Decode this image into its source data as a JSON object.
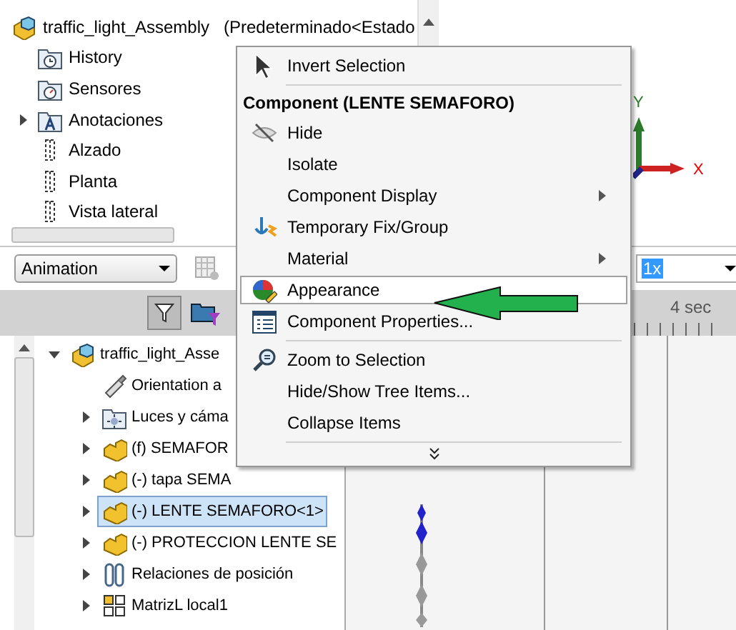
{
  "feature_tree": {
    "root": {
      "label": "traffic_light_Assembly",
      "config": "(Predeterminado<Estado",
      "kind": "assembly"
    },
    "items": [
      {
        "label": "History",
        "kind": "history"
      },
      {
        "label": "Sensores",
        "kind": "sensors"
      },
      {
        "label": "Anotaciones",
        "kind": "annotations",
        "expanded": false
      },
      {
        "label": "Alzado",
        "kind": "plane"
      },
      {
        "label": "Planta",
        "kind": "plane"
      },
      {
        "label": "Vista lateral",
        "kind": "plane"
      }
    ]
  },
  "graphics": {
    "axis_labels": [
      "Y",
      "X"
    ]
  },
  "motion_manager": {
    "study_type": "Animation",
    "playback_speed": "1x",
    "time_label": "4 sec",
    "tree": {
      "label": "traffic_light_Asse",
      "kind": "assembly",
      "expanded": true,
      "children": [
        {
          "label": "Orientation a",
          "kind": "orientation",
          "selected": false
        },
        {
          "label": "Luces y cáma",
          "kind": "lights",
          "expanded": false,
          "selected": false
        },
        {
          "label": "(f) SEMAFOR",
          "kind": "part",
          "expanded": false,
          "selected": false
        },
        {
          "label": "(-) tapa SEMA",
          "kind": "part",
          "expanded": false,
          "selected": false
        },
        {
          "label": "(-) LENTE SEMAFORO<1>",
          "kind": "part",
          "expanded": false,
          "selected": true
        },
        {
          "label": "(-) PROTECCION LENTE SE",
          "kind": "part",
          "expanded": false,
          "selected": false
        },
        {
          "label": "Relaciones de posición",
          "kind": "mates",
          "expanded": false,
          "selected": false
        },
        {
          "label": "MatrizL local1",
          "kind": "pattern",
          "expanded": false,
          "selected": false
        }
      ]
    }
  },
  "context_menu": [
    {
      "kind": "cursor",
      "label": "Invert Selection",
      "submenu": false,
      "selected": false
    },
    {
      "kind": "separator"
    },
    {
      "kind": "header",
      "label": "Component (LENTE SEMAFORO)"
    },
    {
      "kind": "eye",
      "label": "Hide",
      "submenu": false,
      "selected": false
    },
    {
      "kind": "plain",
      "label": "Isolate",
      "submenu": false,
      "selected": false
    },
    {
      "kind": "plain",
      "label": "Component Display",
      "submenu": true,
      "selected": false
    },
    {
      "kind": "anchor",
      "label": "Temporary Fix/Group",
      "submenu": false,
      "selected": false
    },
    {
      "kind": "plain",
      "label": "Material",
      "submenu": true,
      "selected": false
    },
    {
      "kind": "appearance",
      "label": "Appearance",
      "submenu": false,
      "selected": true
    },
    {
      "kind": "properties",
      "label": "Component Properties...",
      "submenu": false,
      "selected": false
    },
    {
      "kind": "separator"
    },
    {
      "kind": "zoom",
      "label": "Zoom to Selection",
      "submenu": false,
      "selected": false
    },
    {
      "kind": "plain",
      "label": "Hide/Show Tree Items...",
      "submenu": false,
      "selected": false
    },
    {
      "kind": "plain",
      "label": "Collapse Items",
      "submenu": false,
      "selected": false
    },
    {
      "kind": "separator"
    },
    {
      "kind": "more"
    }
  ]
}
